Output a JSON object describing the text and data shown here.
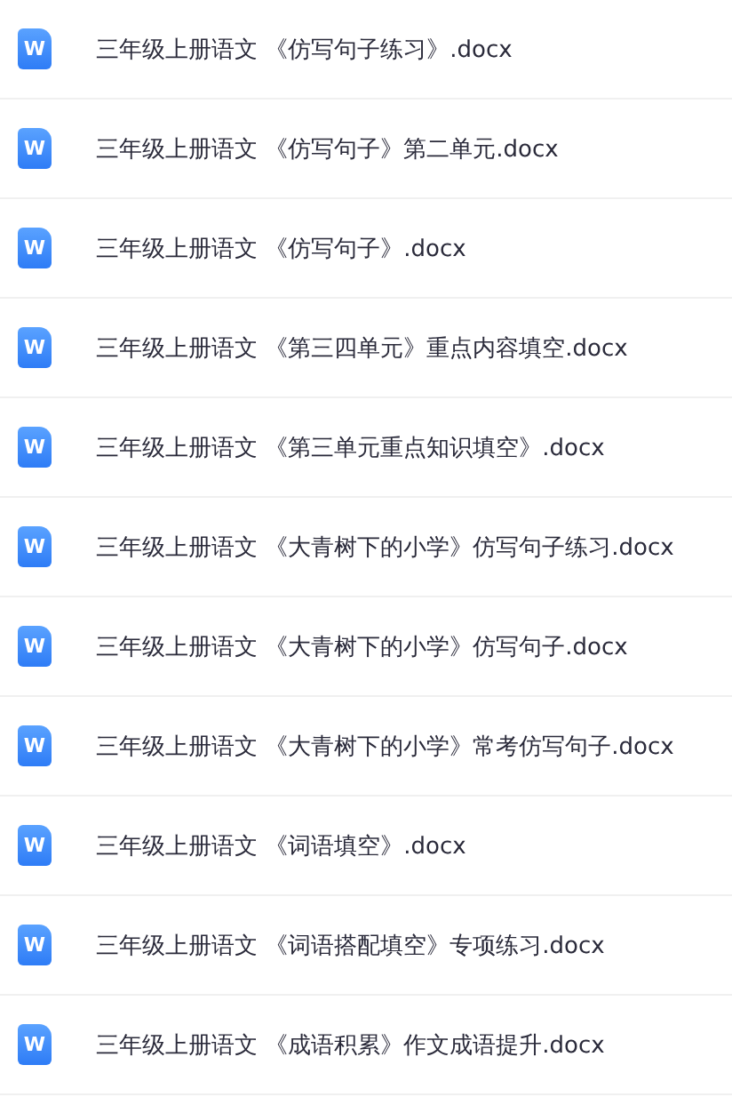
{
  "files": [
    {
      "icon_letter": "W",
      "name": "三年级上册语文 《仿写句子练习》.docx"
    },
    {
      "icon_letter": "W",
      "name": "三年级上册语文 《仿写句子》第二单元.docx"
    },
    {
      "icon_letter": "W",
      "name": "三年级上册语文 《仿写句子》.docx"
    },
    {
      "icon_letter": "W",
      "name": "三年级上册语文 《第三四单元》重点内容填空.docx"
    },
    {
      "icon_letter": "W",
      "name": "三年级上册语文 《第三单元重点知识填空》.docx"
    },
    {
      "icon_letter": "W",
      "name": "三年级上册语文 《大青树下的小学》仿写句子练习.docx"
    },
    {
      "icon_letter": "W",
      "name": "三年级上册语文 《大青树下的小学》仿写句子.docx"
    },
    {
      "icon_letter": "W",
      "name": "三年级上册语文 《大青树下的小学》常考仿写句子.docx"
    },
    {
      "icon_letter": "W",
      "name": "三年级上册语文 《词语填空》.docx"
    },
    {
      "icon_letter": "W",
      "name": "三年级上册语文 《词语搭配填空》专项练习.docx"
    },
    {
      "icon_letter": "W",
      "name": "三年级上册语文 《成语积累》作文成语提升.docx"
    }
  ]
}
